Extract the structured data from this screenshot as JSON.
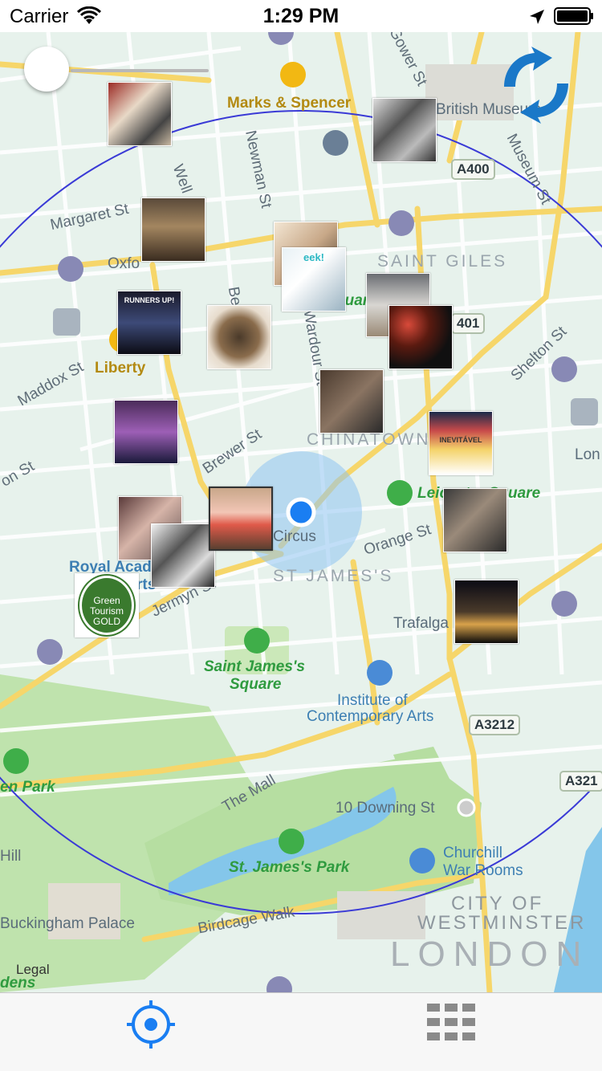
{
  "status_bar": {
    "carrier": "Carrier",
    "time": "1:29 PM",
    "wifi_icon": "wifi-icon",
    "location_icon": "location-arrow-icon",
    "battery_icon": "battery-icon"
  },
  "map": {
    "labels": {
      "marks_spencer": "Marks & Spencer",
      "british_museum": "British Museum",
      "a400": "A400",
      "margaret_st": "Margaret St",
      "newman_st": "Newman St",
      "well": "Well",
      "gower_st": "Gower St",
      "museum_st": "Museum St",
      "oxford": "Oxfo",
      "saint_giles": "SAINT GILES",
      "square": "quare",
      "a401": "401",
      "liberty": "Liberty",
      "maddox_st": "Maddox St",
      "shelton_st": "Shelton St",
      "wardour_st": "Wardour St",
      "berwick_st": "Be",
      "chinatown": "CHINATOWN",
      "on_st": "on St",
      "brewer_st": "Brewer St",
      "leicester_square": "Leicester Square",
      "circus": "Circus",
      "orange_st": "Orange St",
      "st_james": "ST JAMES'S",
      "royal_academy": "Royal Acad",
      "royal_academy_2": "rts",
      "jermyn_st": "Jermyn St",
      "trafalgar": "Trafalga",
      "saint_james_square_1": "Saint James's",
      "saint_james_square_2": "Square",
      "institute_1": "Institute of",
      "institute_2": "Contemporary Arts",
      "a3212": "A3212",
      "green_park": "en Park",
      "the_mall": "The Mall",
      "downing_st": "10 Downing St",
      "a321": "A321",
      "churchill_1": "Churchill",
      "churchill_2": "War Rooms",
      "hill": "Hill",
      "st_james_park": "St. James's Park",
      "buckingham_palace": "Buckingham Palace",
      "birdcage_walk": "Birdcage Walk",
      "city_of_1": "CITY OF",
      "city_of_2": "WESTMINSTER",
      "london": "LONDON",
      "lon": "Lon",
      "gardens": "dens"
    },
    "photos": [
      {
        "name": "photo-food-tray",
        "caption": ""
      },
      {
        "name": "photo-shopfront",
        "caption": ""
      },
      {
        "name": "photo-museum-interior",
        "caption": ""
      },
      {
        "name": "photo-runners-up",
        "caption": "RUNNERS UP!"
      },
      {
        "name": "photo-dish",
        "caption": ""
      },
      {
        "name": "photo-models",
        "caption": ""
      },
      {
        "name": "photo-magazine",
        "caption": "eek!"
      },
      {
        "name": "photo-concert",
        "caption": ""
      },
      {
        "name": "photo-street-crowd",
        "caption": ""
      },
      {
        "name": "photo-band",
        "caption": ""
      },
      {
        "name": "photo-neon-bar",
        "caption": ""
      },
      {
        "name": "photo-poster",
        "caption": "INEVITÁVEL"
      },
      {
        "name": "photo-portrait-pink",
        "caption": ""
      },
      {
        "name": "photo-bw-lying",
        "caption": ""
      },
      {
        "name": "photo-two-women",
        "caption": ""
      },
      {
        "name": "photo-group-selfie",
        "caption": ""
      },
      {
        "name": "photo-night-street",
        "caption": ""
      },
      {
        "name": "photo-green-tourism",
        "caption": "Green Tourism GOLD"
      }
    ],
    "legal": "Legal",
    "colors": {
      "radius_circle": "#3a3ad6",
      "user_location": "#1a7ef2",
      "park": "#b6dea1",
      "water": "#84c6ea",
      "road_major": "#f6d66a",
      "road_minor": "#ffffff"
    }
  },
  "controls": {
    "radius_slider_icon": "slider-icon",
    "refresh_icon": "refresh-arrows-icon"
  },
  "tab_bar": {
    "tabs": [
      {
        "icon": "crosshair-icon",
        "selected": true
      },
      {
        "icon": "grid-icon",
        "selected": false
      }
    ]
  }
}
